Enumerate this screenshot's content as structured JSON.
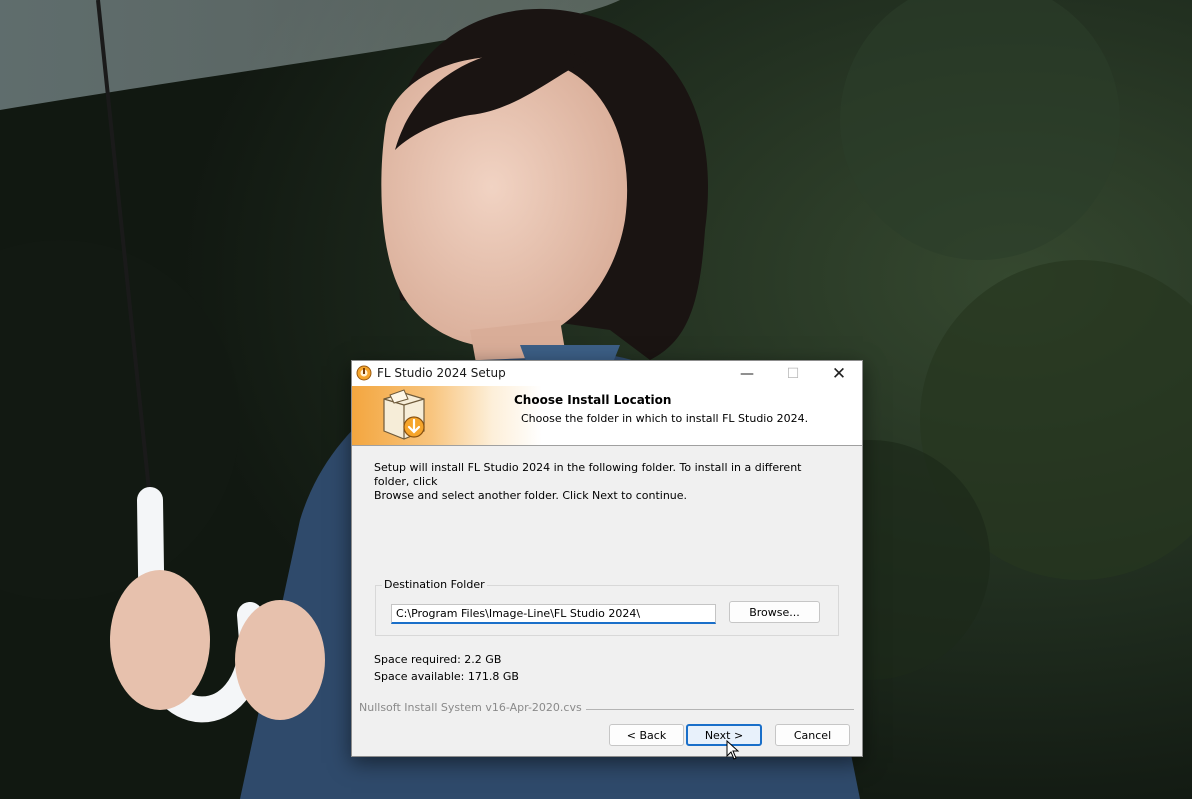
{
  "window": {
    "title": "FL Studio 2024 Setup"
  },
  "header": {
    "title": "Choose Install Location",
    "subtitle": "Choose the folder in which to install FL Studio 2024."
  },
  "body": {
    "intro_line1": "Setup will install FL Studio 2024 in the following folder. To install in a different folder, click",
    "intro_line2": "Browse and select another folder. Click Next to continue."
  },
  "destination": {
    "group_label": "Destination Folder",
    "path": "C:\\Program Files\\Image-Line\\FL Studio 2024\\",
    "browse_label": "Browse..."
  },
  "space": {
    "required": "Space required: 2.2 GB",
    "available": "Space available: 171.8 GB"
  },
  "footer": {
    "branding": "Nullsoft Install System v16-Apr-2020.cvs",
    "back_label": "< Back",
    "next_label": "Next >",
    "cancel_label": "Cancel"
  },
  "colors": {
    "header_accent": "#f3a63f",
    "focus_blue": "#1a6fc9",
    "dialog_bg": "#f0f0f0"
  },
  "icons": {
    "app": "fl-studio-setup-icon",
    "header": "installer-box-download-icon"
  }
}
